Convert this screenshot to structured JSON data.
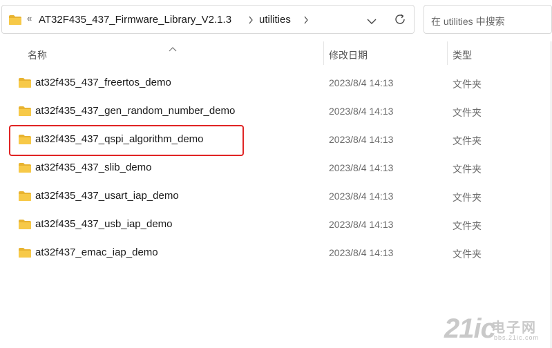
{
  "address_bar": {
    "overflow_glyph": "«",
    "crumbs": [
      "AT32F435_437_Firmware_Library_V2.1.3",
      "utilities"
    ],
    "separator_icon": "chevron-right-icon",
    "dropdown_icon": "chevron-down-icon",
    "refresh_icon": "refresh-icon"
  },
  "search": {
    "placeholder": "在 utilities 中搜索"
  },
  "columns": {
    "name": "名称",
    "modified": "修改日期",
    "type": "类型"
  },
  "files": [
    {
      "name": "at32f435_437_freertos_demo",
      "modified": "2023/8/4 14:13",
      "type": "文件夹"
    },
    {
      "name": "at32f435_437_gen_random_number_demo",
      "modified": "2023/8/4 14:13",
      "type": "文件夹"
    },
    {
      "name": "at32f435_437_qspi_algorithm_demo",
      "modified": "2023/8/4 14:13",
      "type": "文件夹"
    },
    {
      "name": "at32f435_437_slib_demo",
      "modified": "2023/8/4 14:13",
      "type": "文件夹"
    },
    {
      "name": "at32f435_437_usart_iap_demo",
      "modified": "2023/8/4 14:13",
      "type": "文件夹"
    },
    {
      "name": "at32f435_437_usb_iap_demo",
      "modified": "2023/8/4 14:13",
      "type": "文件夹"
    },
    {
      "name": "at32f437_emac_iap_demo",
      "modified": "2023/8/4 14:13",
      "type": "文件夹"
    }
  ],
  "highlighted_row": "at32f435_437_qspi_algorithm_demo",
  "watermark": {
    "big": "21ic",
    "cn": "电子网",
    "small": "bbs.21ic.com"
  },
  "colors": {
    "folder": "#f7c948",
    "folder_dark": "#e8b330",
    "highlight": "#e02424"
  }
}
